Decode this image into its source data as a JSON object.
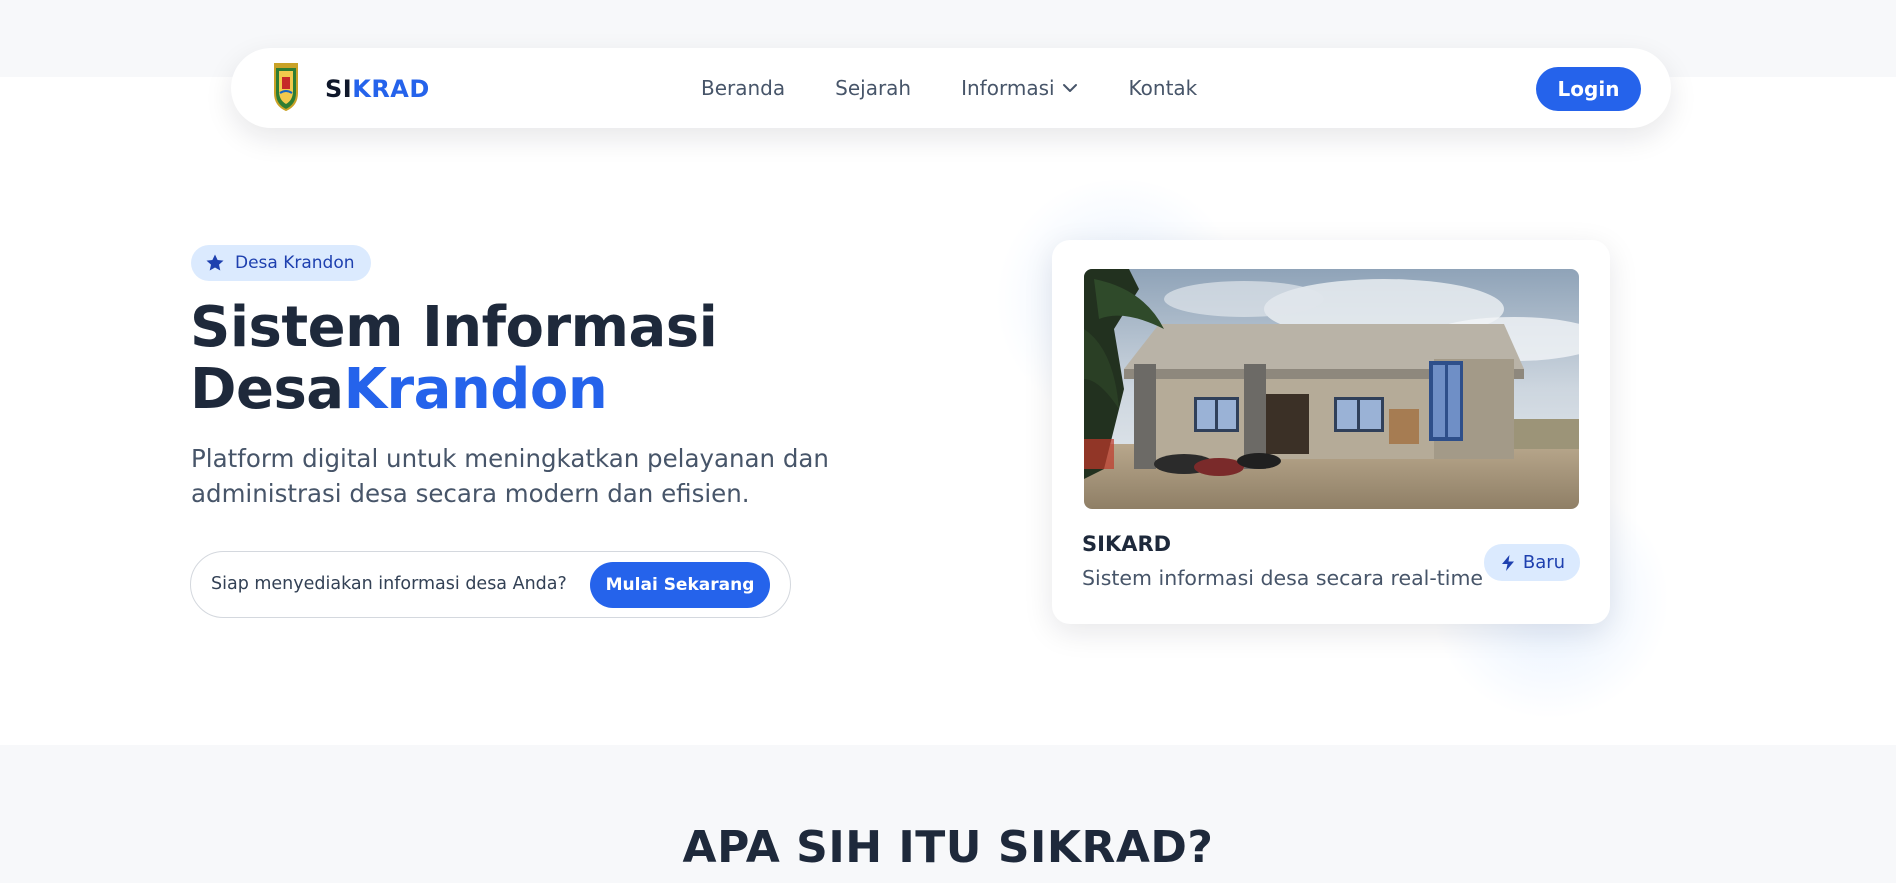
{
  "nav": {
    "brand_part1": "SI",
    "brand_part2": "KRAD",
    "links": [
      {
        "label": "Beranda"
      },
      {
        "label": "Sejarah"
      },
      {
        "label": "Informasi",
        "icon": "chevron-down-icon"
      },
      {
        "label": "Kontak"
      }
    ],
    "login_label": "Login"
  },
  "hero": {
    "badge_label": "Desa Krandon",
    "badge_icon": "star-icon",
    "title_line1": "Sistem Informasi",
    "title_line2_plain": "Desa",
    "title_line2_highlight": "Krandon",
    "subtitle": "Platform digital untuk meningkatkan pelayanan dan administrasi desa secara modern dan efisien.",
    "cta_prompt": "Siap menyediakan informasi desa Anda?",
    "cta_button": "Mulai Sekarang"
  },
  "card": {
    "title": "SIKARD",
    "description": "Sistem informasi desa secara real-time",
    "badge_label": "Baru",
    "badge_icon": "bolt-icon"
  },
  "section2": {
    "title": "APA SIH ITU SIKRAD?"
  },
  "colors": {
    "primary": "#2563eb",
    "badge_bg": "#dbeafe",
    "badge_text": "#1e40af",
    "heading": "#1e293b",
    "body_text": "#475569"
  }
}
